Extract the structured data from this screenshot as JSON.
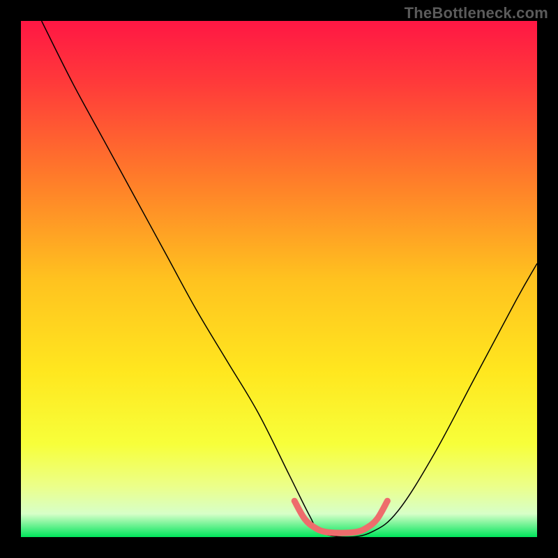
{
  "watermark": "TheBottleneck.com",
  "chart_data": {
    "type": "line",
    "title": "",
    "xlabel": "",
    "ylabel": "",
    "xlim": [
      0,
      100
    ],
    "ylim": [
      0,
      100
    ],
    "grid": false,
    "legend": false,
    "gradient_stops": [
      {
        "offset": 0.0,
        "color": "#ff1744"
      },
      {
        "offset": 0.12,
        "color": "#ff3a3a"
      },
      {
        "offset": 0.3,
        "color": "#ff7a2a"
      },
      {
        "offset": 0.5,
        "color": "#ffc21f"
      },
      {
        "offset": 0.68,
        "color": "#ffe71f"
      },
      {
        "offset": 0.82,
        "color": "#f7ff3a"
      },
      {
        "offset": 0.9,
        "color": "#ecff88"
      },
      {
        "offset": 0.955,
        "color": "#d7ffc8"
      },
      {
        "offset": 1.0,
        "color": "#00e55b"
      }
    ],
    "series": [
      {
        "name": "bottleneck-curve",
        "color": "#000000",
        "stroke_width": 1.5,
        "x": [
          4,
          10,
          16,
          22,
          28,
          34,
          40,
          46,
          52,
          56,
          58,
          63,
          68,
          73,
          80,
          88,
          96,
          100
        ],
        "y": [
          100,
          88,
          77,
          66,
          55,
          44,
          34,
          24,
          12,
          4,
          1,
          0,
          1,
          5,
          16,
          31,
          46,
          53
        ]
      },
      {
        "name": "optimal-band",
        "color": "#ee6c6c",
        "stroke_width": 9,
        "x": [
          53,
          55,
          57,
          59,
          62,
          65,
          67,
          69,
          71
        ],
        "y": [
          7,
          3.5,
          1.8,
          1.0,
          0.8,
          1.0,
          1.8,
          3.5,
          7
        ]
      }
    ]
  }
}
